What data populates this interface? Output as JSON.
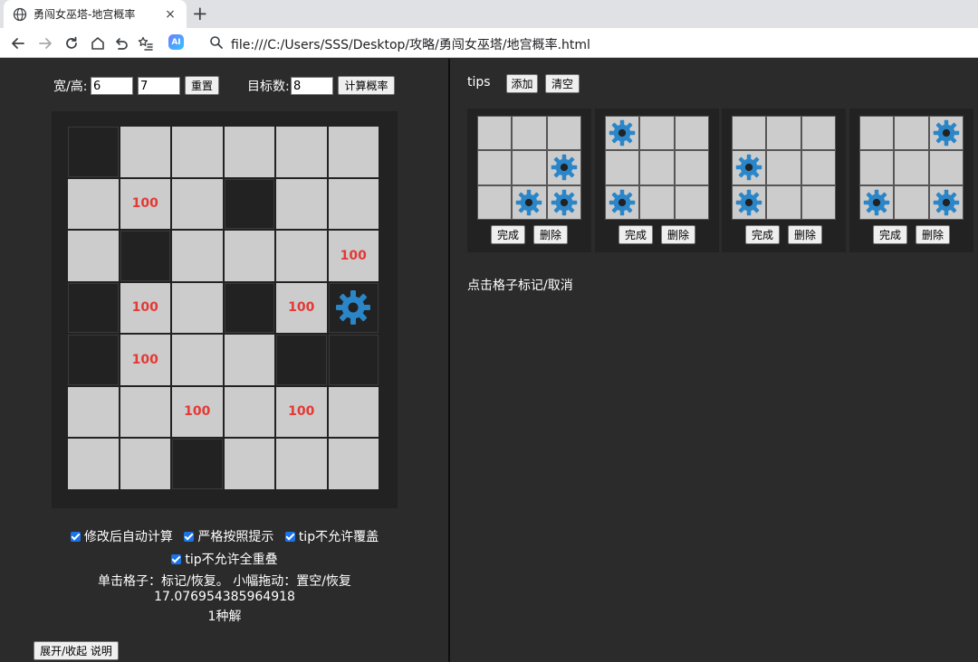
{
  "browser": {
    "tab_title": "勇闯女巫塔-地宫概率",
    "tab_close": "×",
    "new_tab": "+",
    "url": "file:///C:/Users/SSS/Desktop/攻略/勇闯女巫塔/地宫概率.html",
    "ai_badge": "AI"
  },
  "controls": {
    "size_label": "宽/高:",
    "width_value": "6",
    "height_value": "7",
    "reset_button": "重置",
    "target_label": "目标数:",
    "target_value": "8",
    "calc_button": "计算概率"
  },
  "board": {
    "rows": 7,
    "cols": 6,
    "cells": [
      [
        "dark",
        "light",
        "light",
        "light",
        "light",
        "light"
      ],
      [
        "light",
        "light:100",
        "light",
        "dark",
        "light",
        "light"
      ],
      [
        "light",
        "dark",
        "light",
        "light",
        "light",
        "light:100"
      ],
      [
        "dark",
        "light:100",
        "light",
        "dark",
        "light:100",
        "gear"
      ],
      [
        "dark",
        "light:100",
        "light",
        "light",
        "dark",
        "dark"
      ],
      [
        "light",
        "light",
        "light:100",
        "light",
        "light:100",
        "light"
      ],
      [
        "light",
        "light",
        "dark",
        "light",
        "light",
        "light"
      ]
    ]
  },
  "options": {
    "auto_calc": "修改后自动计算",
    "strict_hint": "严格按照提示",
    "tip_no_cover": "tip不允许覆盖",
    "tip_no_overlap": "tip不允许全重叠"
  },
  "help": {
    "usage": "单击格子：标记/恢复。 小幅拖动：置空/恢复",
    "result_value": "17.076954385964918",
    "solutions": "1种解",
    "toggle_button": "展开/收起 说明"
  },
  "tips": {
    "title": "tips",
    "add_button": "添加",
    "clear_button": "清空",
    "done_label": "完成",
    "delete_label": "删除",
    "hint": "点击格子标记/取消",
    "cards": [
      [
        [
          0,
          0,
          0
        ],
        [
          0,
          0,
          1
        ],
        [
          0,
          1,
          1
        ]
      ],
      [
        [
          1,
          0,
          0
        ],
        [
          0,
          0,
          0
        ],
        [
          1,
          0,
          0
        ]
      ],
      [
        [
          0,
          0,
          0
        ],
        [
          1,
          0,
          0
        ],
        [
          1,
          0,
          0
        ]
      ],
      [
        [
          0,
          0,
          1
        ],
        [
          0,
          0,
          0
        ],
        [
          1,
          0,
          1
        ]
      ]
    ]
  },
  "colors": {
    "gear": "#2a86c8",
    "marked_text": "#e53935",
    "cell_light": "#cccccc",
    "cell_dark": "#222222"
  }
}
